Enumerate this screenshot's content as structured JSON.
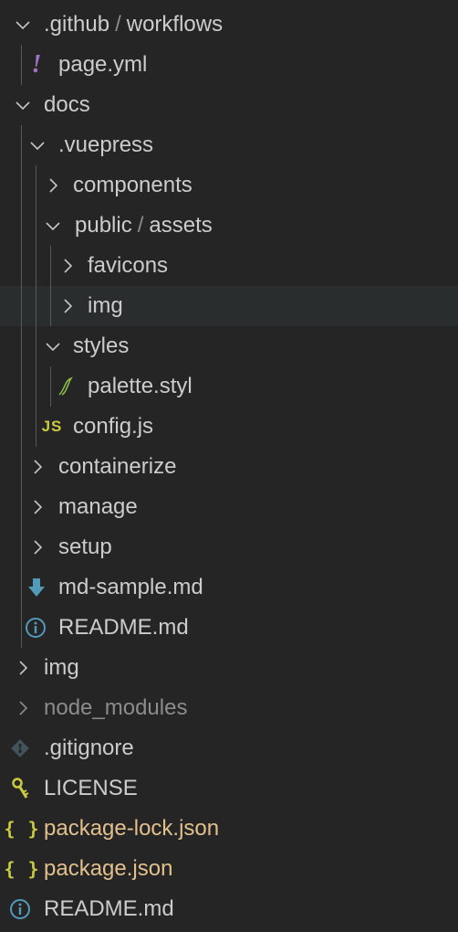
{
  "explorer": {
    "rows": [
      {
        "parts": [
          ".github",
          "workflows"
        ],
        "separator": "/"
      },
      {
        "label": "page.yml",
        "icon": "yml-icon"
      },
      {
        "label": "docs"
      },
      {
        "label": ".vuepress"
      },
      {
        "label": "components"
      },
      {
        "parts": [
          "public",
          "assets"
        ],
        "separator": "/"
      },
      {
        "label": "favicons"
      },
      {
        "label": "img"
      },
      {
        "label": "styles"
      },
      {
        "label": "palette.styl",
        "icon": "stylus-icon"
      },
      {
        "label": "config.js",
        "icon": "js-icon",
        "icon_text": "JS"
      },
      {
        "label": "containerize"
      },
      {
        "label": "manage"
      },
      {
        "label": "setup"
      },
      {
        "label": "md-sample.md",
        "icon": "markdown-icon"
      },
      {
        "label": "README.md",
        "icon": "info-icon"
      },
      {
        "label": "img"
      },
      {
        "label": "node_modules"
      },
      {
        "label": ".gitignore",
        "icon": "git-icon"
      },
      {
        "label": "LICENSE",
        "icon": "license-key-icon"
      },
      {
        "label": "package-lock.json",
        "icon": "json-icon",
        "icon_text": "{ }"
      },
      {
        "label": "package.json",
        "icon": "json-icon",
        "icon_text": "{ }"
      },
      {
        "label": "README.md",
        "icon": "info-icon"
      }
    ]
  },
  "colors": {
    "background": "#252526",
    "hover_row": "#2a2d2e",
    "text": "#cccccc",
    "muted_text": "#8c8c8c",
    "json_text": "#e2c08d",
    "yml_icon": "#a074c4",
    "js_icon": "#cbcb41",
    "markdown_icon": "#519aba",
    "git_icon": "#41535b",
    "stylus_icon": "#8dc149",
    "license_icon": "#cbcb41",
    "indent_guide": "#585858"
  }
}
